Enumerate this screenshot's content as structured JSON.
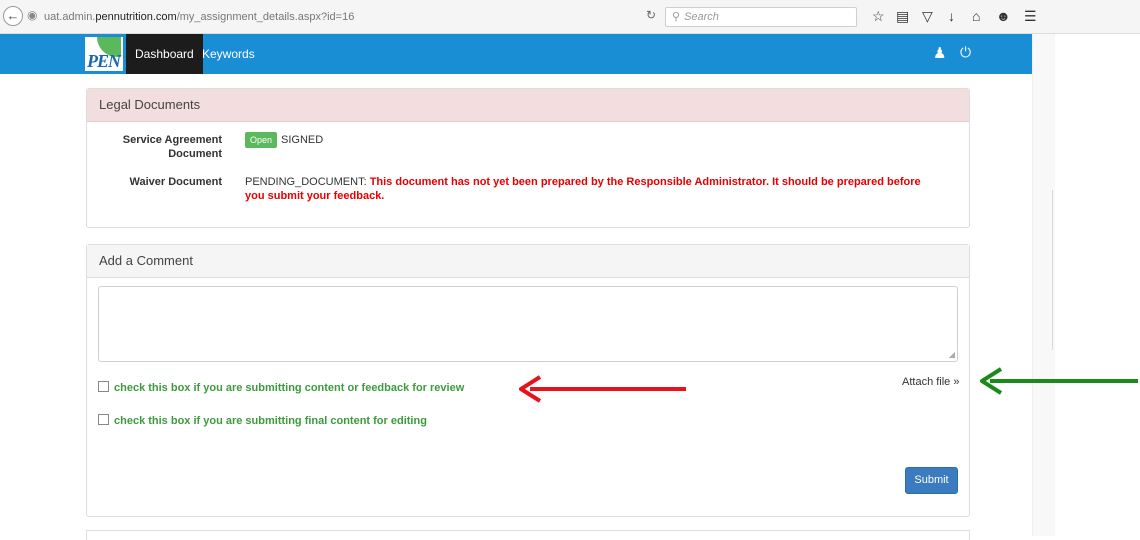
{
  "browser": {
    "url_prefix": "uat.admin.",
    "url_host": "pennutrition.com",
    "url_path": "/my_assignment_details.aspx?id=16",
    "search_placeholder": "Search"
  },
  "nav": {
    "logo_text": "PEN",
    "tabs": [
      {
        "label": "Dashboard",
        "active": true
      },
      {
        "label": "Keywords",
        "active": false
      }
    ]
  },
  "legal": {
    "title": "Legal Documents",
    "rows": [
      {
        "label_line1": "Service Agreement",
        "label_line2": "Document",
        "button": "Open",
        "status": "SIGNED"
      },
      {
        "label": "Waiver Document",
        "status": "PENDING_DOCUMENT:",
        "warning_line1": "This document has not yet been prepared by the Responsible Administrator. It should be prepared before",
        "warning_line2": "you submit your feedback."
      }
    ]
  },
  "comment": {
    "title": "Add a Comment",
    "checkbox_review": "check this box if you are submitting content or feedback for review",
    "checkbox_final": "check this box if you are submitting final content for editing",
    "attach_label": "Attach file »",
    "submit_label": "Submit"
  },
  "colors": {
    "nav_bg": "#1a8ed4",
    "legal_header_bg": "#f2dede",
    "warning_text": "#e60000",
    "checkbox_text": "#3c9b3c",
    "submit_bg": "#3b7bbf",
    "annotation_red": "#e8121a",
    "annotation_green": "#1a8a1a"
  }
}
